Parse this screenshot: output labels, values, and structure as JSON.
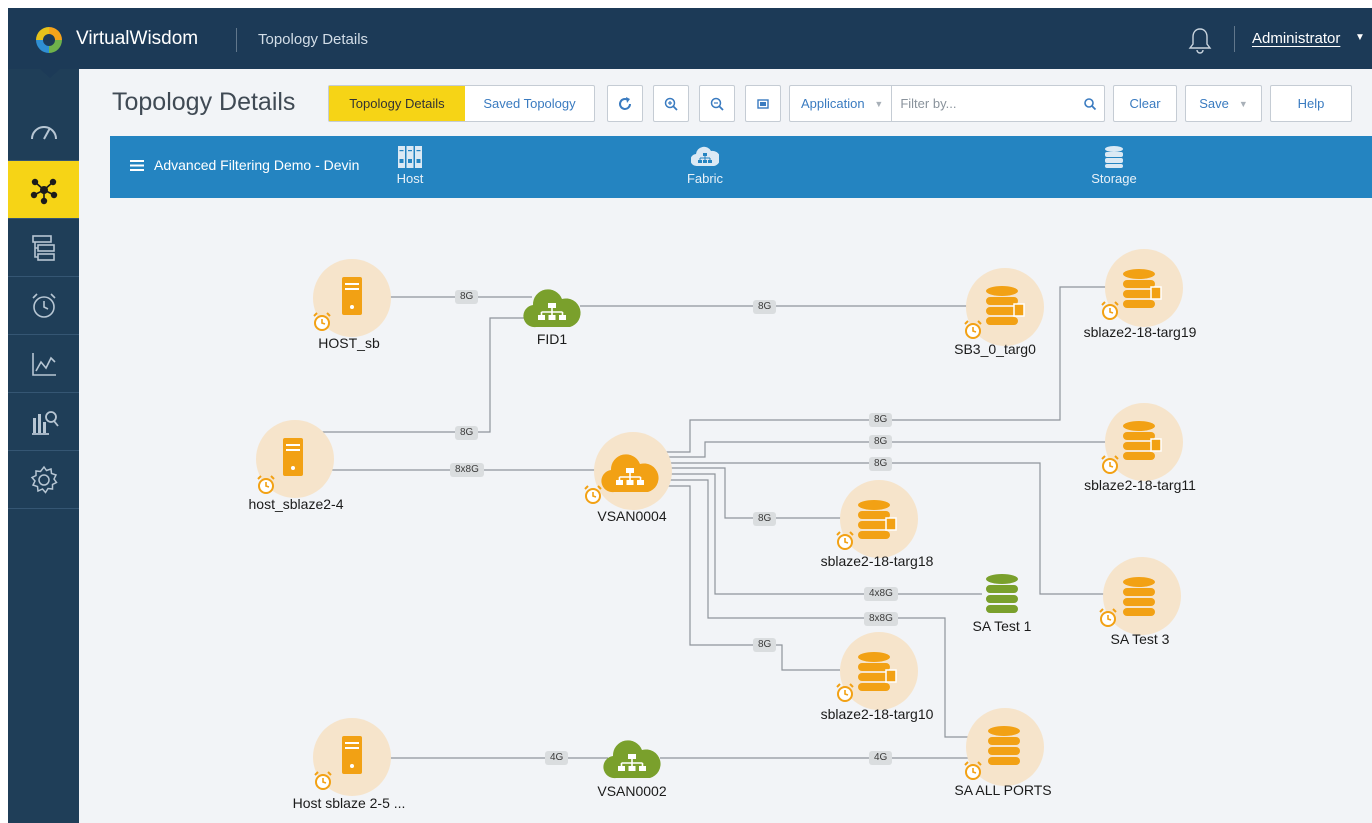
{
  "app": {
    "brand": "VirtualWisdom",
    "breadcrumb": "Topology Details",
    "user": "Administrator"
  },
  "sidebar": {
    "items": [
      {
        "icon": "gauge-icon",
        "active": false
      },
      {
        "icon": "topology-icon",
        "active": true
      },
      {
        "icon": "hierarchy-icon",
        "active": false
      },
      {
        "icon": "alarm-icon",
        "active": false
      },
      {
        "icon": "trend-chart-icon",
        "active": false
      },
      {
        "icon": "analytics-icon",
        "active": false
      },
      {
        "icon": "gear-icon",
        "active": false
      }
    ]
  },
  "toolbar": {
    "title": "Topology Details",
    "tab_active": "Topology Details",
    "tab_other": "Saved Topology",
    "filter_type": "Application",
    "filter_placeholder": "Filter by...",
    "clear": "Clear",
    "save": "Save",
    "help": "Help"
  },
  "banner": {
    "name": "Advanced Filtering Demo - Devin",
    "columns": [
      "Host",
      "Fabric",
      "Storage"
    ]
  },
  "colors": {
    "topbar": "#1c3a57",
    "accent": "#f6d416",
    "banner": "#2484c1",
    "host_node": "#f2a114",
    "fabric_node": "#7aa02c",
    "halo": "#f6e4cb"
  },
  "topology": {
    "nodes": [
      {
        "name": "HOST_sb",
        "kind": "host",
        "alarm": true
      },
      {
        "name": "host_sblaze2-4",
        "kind": "host",
        "alarm": true
      },
      {
        "name": "Host sblaze 2-5 ...",
        "kind": "host",
        "alarm": true
      },
      {
        "name": "FID1",
        "kind": "fabric",
        "alarm": false
      },
      {
        "name": "VSAN0004",
        "kind": "fabric-alert",
        "alarm": true
      },
      {
        "name": "VSAN0002",
        "kind": "fabric",
        "alarm": false
      },
      {
        "name": "SB3_0_targ0",
        "kind": "storage",
        "alarm": true
      },
      {
        "name": "sblaze2-18-targ19",
        "kind": "storage",
        "alarm": true
      },
      {
        "name": "sblaze2-18-targ11",
        "kind": "storage",
        "alarm": true
      },
      {
        "name": "sblaze2-18-targ18",
        "kind": "storage",
        "alarm": true
      },
      {
        "name": "SA Test 1",
        "kind": "storage-ok",
        "alarm": false
      },
      {
        "name": "SA Test 3",
        "kind": "storage",
        "alarm": true
      },
      {
        "name": "sblaze2-18-targ10",
        "kind": "storage",
        "alarm": true
      },
      {
        "name": "SA ALL PORTS",
        "kind": "storage",
        "alarm": true
      }
    ],
    "links": [
      {
        "from": "HOST_sb",
        "to": "FID1",
        "speed": "8G"
      },
      {
        "from": "FID1",
        "to": "SB3_0_targ0",
        "speed": "8G"
      },
      {
        "from": "host_sblaze2-4",
        "to": "FID1",
        "speed": "8G"
      },
      {
        "from": "host_sblaze2-4",
        "to": "VSAN0004",
        "speed": "8x8G"
      },
      {
        "from": "VSAN0004",
        "to": "sblaze2-18-targ19",
        "speed": "8G"
      },
      {
        "from": "VSAN0004",
        "to": "sblaze2-18-targ11",
        "speed": "8G"
      },
      {
        "from": "VSAN0004",
        "to": "SA Test 3",
        "speed": "8G"
      },
      {
        "from": "VSAN0004",
        "to": "sblaze2-18-targ18",
        "speed": "8G"
      },
      {
        "from": "VSAN0004",
        "to": "SA Test 1",
        "speed": "4x8G"
      },
      {
        "from": "VSAN0004",
        "to": "SA ALL PORTS",
        "speed": "8x8G"
      },
      {
        "from": "VSAN0004",
        "to": "sblaze2-18-targ10",
        "speed": "8G"
      },
      {
        "from": "Host sblaze 2-5 ...",
        "to": "VSAN0002",
        "speed": "4G"
      },
      {
        "from": "VSAN0002",
        "to": "SA ALL PORTS",
        "speed": "4G"
      }
    ]
  }
}
